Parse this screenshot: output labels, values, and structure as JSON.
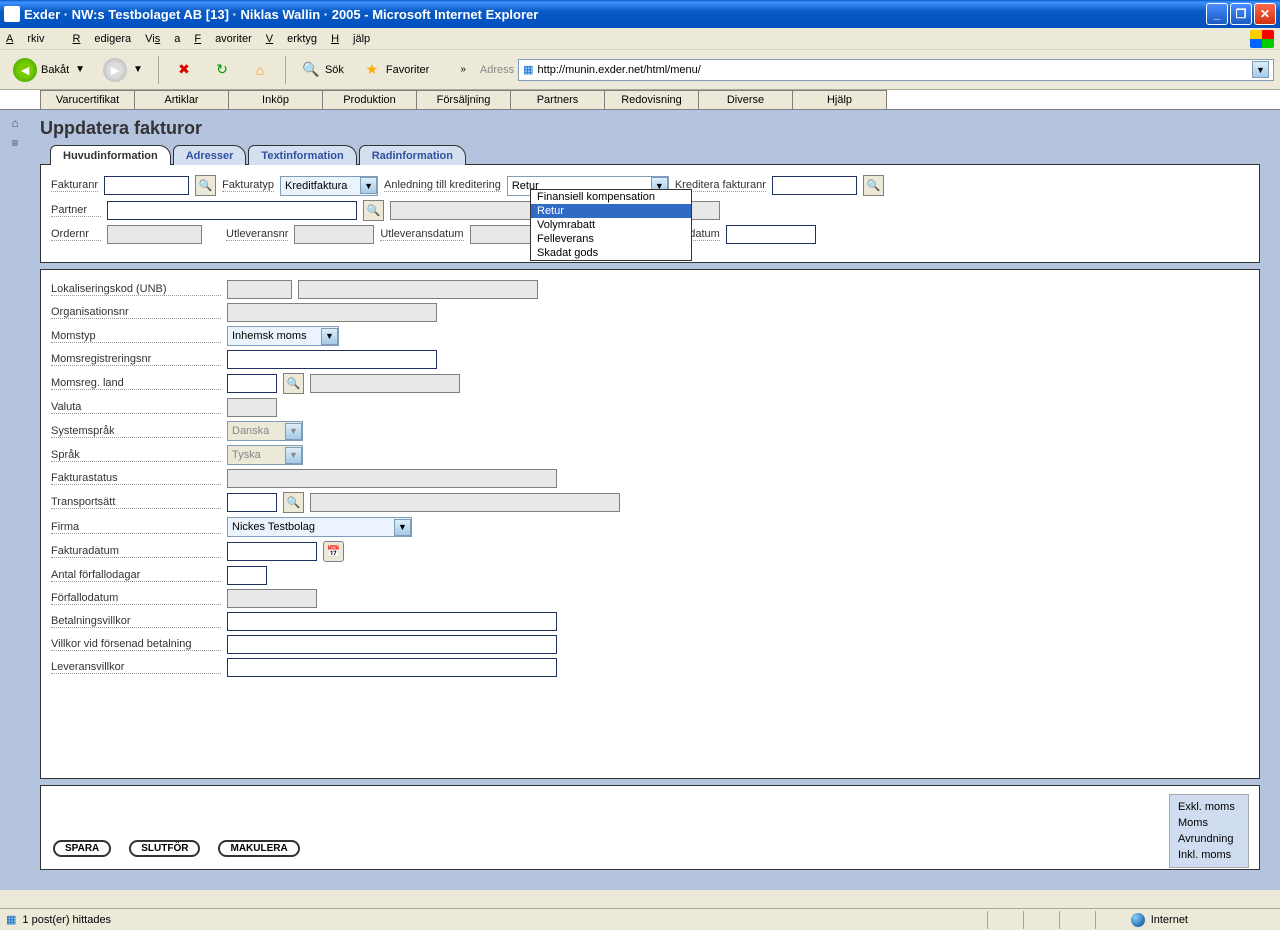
{
  "window": {
    "title": "Exder · NW:s Testbolaget AB [13] · Niklas Wallin · 2005 - Microsoft Internet Explorer"
  },
  "menubar": {
    "arkiv": "Arkiv",
    "redigera": "Redigera",
    "visa": "Visa",
    "favoriter": "Favoriter",
    "verktyg": "Verktyg",
    "hjalp": "Hjälp"
  },
  "toolbar": {
    "back": "Bakåt",
    "search": "Sök",
    "favorites": "Favoriter",
    "address_label": "Adress",
    "url": "http://munin.exder.net/html/menu/"
  },
  "subtabs": [
    "Varucertifikat",
    "Artiklar",
    "Inköp",
    "Produktion",
    "Försäljning",
    "Partners",
    "Redovisning",
    "Diverse",
    "Hjälp"
  ],
  "page_title": "Uppdatera fakturor",
  "tabs": [
    "Huvudinformation",
    "Adresser",
    "Textinformation",
    "Radinformation"
  ],
  "upper": {
    "fakturanr": "Fakturanr",
    "fakturatyp_lbl": "Fakturatyp",
    "fakturatyp_val": "Kreditfaktura",
    "anledning_lbl": "Anledning till kreditering",
    "anledning_val": "Retur",
    "kreditera_lbl": "Kreditera fakturanr",
    "partner_lbl": "Partner",
    "ordernr_lbl": "Ordernr",
    "utleveransnr_lbl": "Utleveransnr",
    "utleveransdatum_lbl": "Utleveransdatum",
    "ankomstdatum_lbl": "mstdatum"
  },
  "dropdown_options": [
    "Finansiell kompensation",
    "Retur",
    "Volymrabatt",
    "Felleverans",
    "Skadat gods"
  ],
  "lower": {
    "lokal": "Lokaliseringskod (UNB)",
    "orgnr": "Organisationsnr",
    "momstyp": "Momstyp",
    "momstyp_val": "Inhemsk moms",
    "momsreg": "Momsregistreringsnr",
    "momsland": "Momsreg. land",
    "valuta": "Valuta",
    "sysspr": "Systemspråk",
    "sysspr_val": "Danska",
    "sprak": "Språk",
    "sprak_val": "Tyska",
    "fstatus": "Fakturastatus",
    "transport": "Transportsätt",
    "firma": "Firma",
    "firma_val": "Nickes Testbolag",
    "fdatum": "Fakturadatum",
    "antal": "Antal förfallodagar",
    "forfallo": "Förfallodatum",
    "betvillkor": "Betalningsvillkor",
    "villkorforsen": "Villkor vid försenad betalning",
    "levvillkor": "Leveransvillkor"
  },
  "buttons": {
    "spara": "SPARA",
    "slutfor": "SLUTFÖR",
    "makulera": "MAKULERA"
  },
  "totals": {
    "exkl": "Exkl. moms",
    "moms": "Moms",
    "avr": "Avrundning",
    "inkl": "Inkl. moms"
  },
  "status": {
    "left": "1 post(er) hittades",
    "internet": "Internet"
  }
}
